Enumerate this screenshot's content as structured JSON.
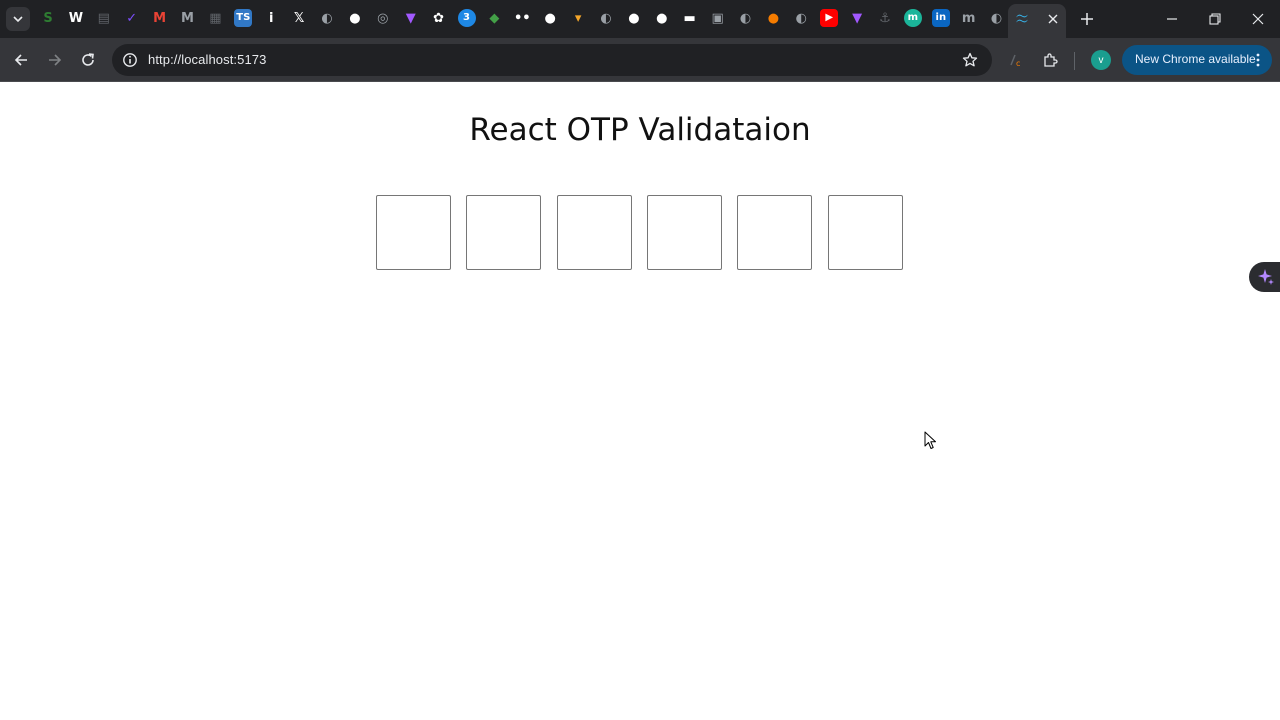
{
  "browser": {
    "pinned_tabs": [
      {
        "icon": "search-tabs-icon",
        "color": "#35363a"
      },
      {
        "icon": "green-s-icon",
        "color": "#2e7d32"
      },
      {
        "icon": "w-icon",
        "color": "#ffffff"
      },
      {
        "icon": "doc-icon",
        "color": "#5f6368"
      },
      {
        "icon": "checkmark-icon",
        "color": "#7c4dff"
      },
      {
        "icon": "gmail-icon",
        "color": "#ea4335"
      },
      {
        "icon": "m-icon",
        "color": "#9aa0a6"
      },
      {
        "icon": "app-icon",
        "color": "#5f6368"
      },
      {
        "icon": "typescript-icon",
        "color": "#3178c6"
      },
      {
        "icon": "info-icon",
        "color": "#ffffff"
      },
      {
        "icon": "x-icon",
        "color": "#ffffff"
      },
      {
        "icon": "globe-icon",
        "color": "#9aa0a6"
      },
      {
        "icon": "github-icon",
        "color": "#ffffff"
      },
      {
        "icon": "circle-icon",
        "color": "#9aa0a6"
      },
      {
        "icon": "vite-icon",
        "color": "#a259ff"
      },
      {
        "icon": "chatgpt-icon",
        "color": "#ffffff"
      },
      {
        "icon": "blue-circle-icon",
        "color": "#1e88e5"
      },
      {
        "icon": "bird-icon",
        "color": "#43a047"
      },
      {
        "icon": "dots-icon",
        "color": "#ffffff"
      },
      {
        "icon": "github-icon",
        "color": "#ffffff"
      },
      {
        "icon": "fox-icon",
        "color": "#f4a62a"
      },
      {
        "icon": "globe-icon",
        "color": "#9aa0a6"
      },
      {
        "icon": "github-icon",
        "color": "#ffffff"
      },
      {
        "icon": "github-icon",
        "color": "#ffffff"
      },
      {
        "icon": "sheet-icon",
        "color": "#ffffff"
      },
      {
        "icon": "image-icon",
        "color": "#9aa0a6"
      },
      {
        "icon": "globe-icon",
        "color": "#9aa0a6"
      },
      {
        "icon": "lightbulb-icon",
        "color": "#f57c00"
      },
      {
        "icon": "globe-icon",
        "color": "#9aa0a6"
      },
      {
        "icon": "youtube-icon",
        "color": "#ff0000"
      },
      {
        "icon": "vite-icon",
        "color": "#a259ff"
      },
      {
        "icon": "anchor-icon",
        "color": "#5f6368"
      },
      {
        "icon": "m-circle-icon",
        "color": "#1bb59a"
      },
      {
        "icon": "linkedin-icon",
        "color": "#0a66c2"
      },
      {
        "icon": "m-dots-icon",
        "color": "#9aa0a6"
      },
      {
        "icon": "globe-icon",
        "color": "#9aa0a6"
      }
    ],
    "active_tab_icon": "tailwind-icon",
    "accent_color": "#38bdf8",
    "url": "http://localhost:5173",
    "profile_initial": "v",
    "update_label": "New Chrome available"
  },
  "page": {
    "title": "React OTP Validataion",
    "otp_inputs": [
      "",
      "",
      "",
      "",
      "",
      ""
    ]
  }
}
